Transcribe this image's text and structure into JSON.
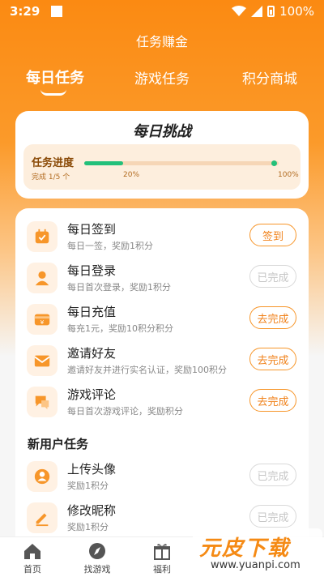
{
  "status_bar": {
    "time": "3:29",
    "battery": "100%"
  },
  "header": {
    "title": "任务赚金"
  },
  "tabs": [
    {
      "label": "每日任务",
      "active": true
    },
    {
      "label": "游戏任务",
      "active": false
    },
    {
      "label": "积分商城",
      "active": false
    }
  ],
  "challenge": {
    "title": "每日挑战",
    "progress_label": "任务进度",
    "completed_text": "完成 1/5 个",
    "progress": 0.2,
    "mark_20": "20%",
    "mark_100": "100%"
  },
  "daily_tasks": [
    {
      "title": "每日签到",
      "desc": "每日一签，奖励1积分",
      "button": "签到",
      "done": false,
      "icon": "calendar-check-icon"
    },
    {
      "title": "每日登录",
      "desc": "每日首次登录，奖励1积分",
      "button": "已完成",
      "done": true,
      "icon": "user-icon"
    },
    {
      "title": "每日充值",
      "desc": "每充1元，奖励10积分积分",
      "button": "去完成",
      "done": false,
      "icon": "wallet-yen-icon"
    },
    {
      "title": "邀请好友",
      "desc": "邀请好友并进行实名认证，奖励100积分",
      "button": "去完成",
      "done": false,
      "icon": "invite-mail-icon"
    },
    {
      "title": "游戏评论",
      "desc": "每日首次游戏评论，奖励积分",
      "button": "去完成",
      "done": false,
      "icon": "comment-icon"
    }
  ],
  "new_user_section": {
    "title": "新用户任务"
  },
  "new_user_tasks": [
    {
      "title": "上传头像",
      "desc": "奖励1积分",
      "button": "已完成",
      "done": true,
      "icon": "avatar-icon"
    },
    {
      "title": "修改昵称",
      "desc": "奖励1积分",
      "button": "已完成",
      "done": true,
      "icon": "edit-icon"
    }
  ],
  "bottom_nav": [
    {
      "label": "首页",
      "icon": "home-icon"
    },
    {
      "label": "找游戏",
      "icon": "compass-icon"
    },
    {
      "label": "福利",
      "icon": "gift-icon"
    }
  ],
  "watermark": {
    "main": "元皮下载",
    "sub": "www.yuanpi.com"
  },
  "colors": {
    "accent": "#fb8a12",
    "progress": "#23c07a"
  }
}
